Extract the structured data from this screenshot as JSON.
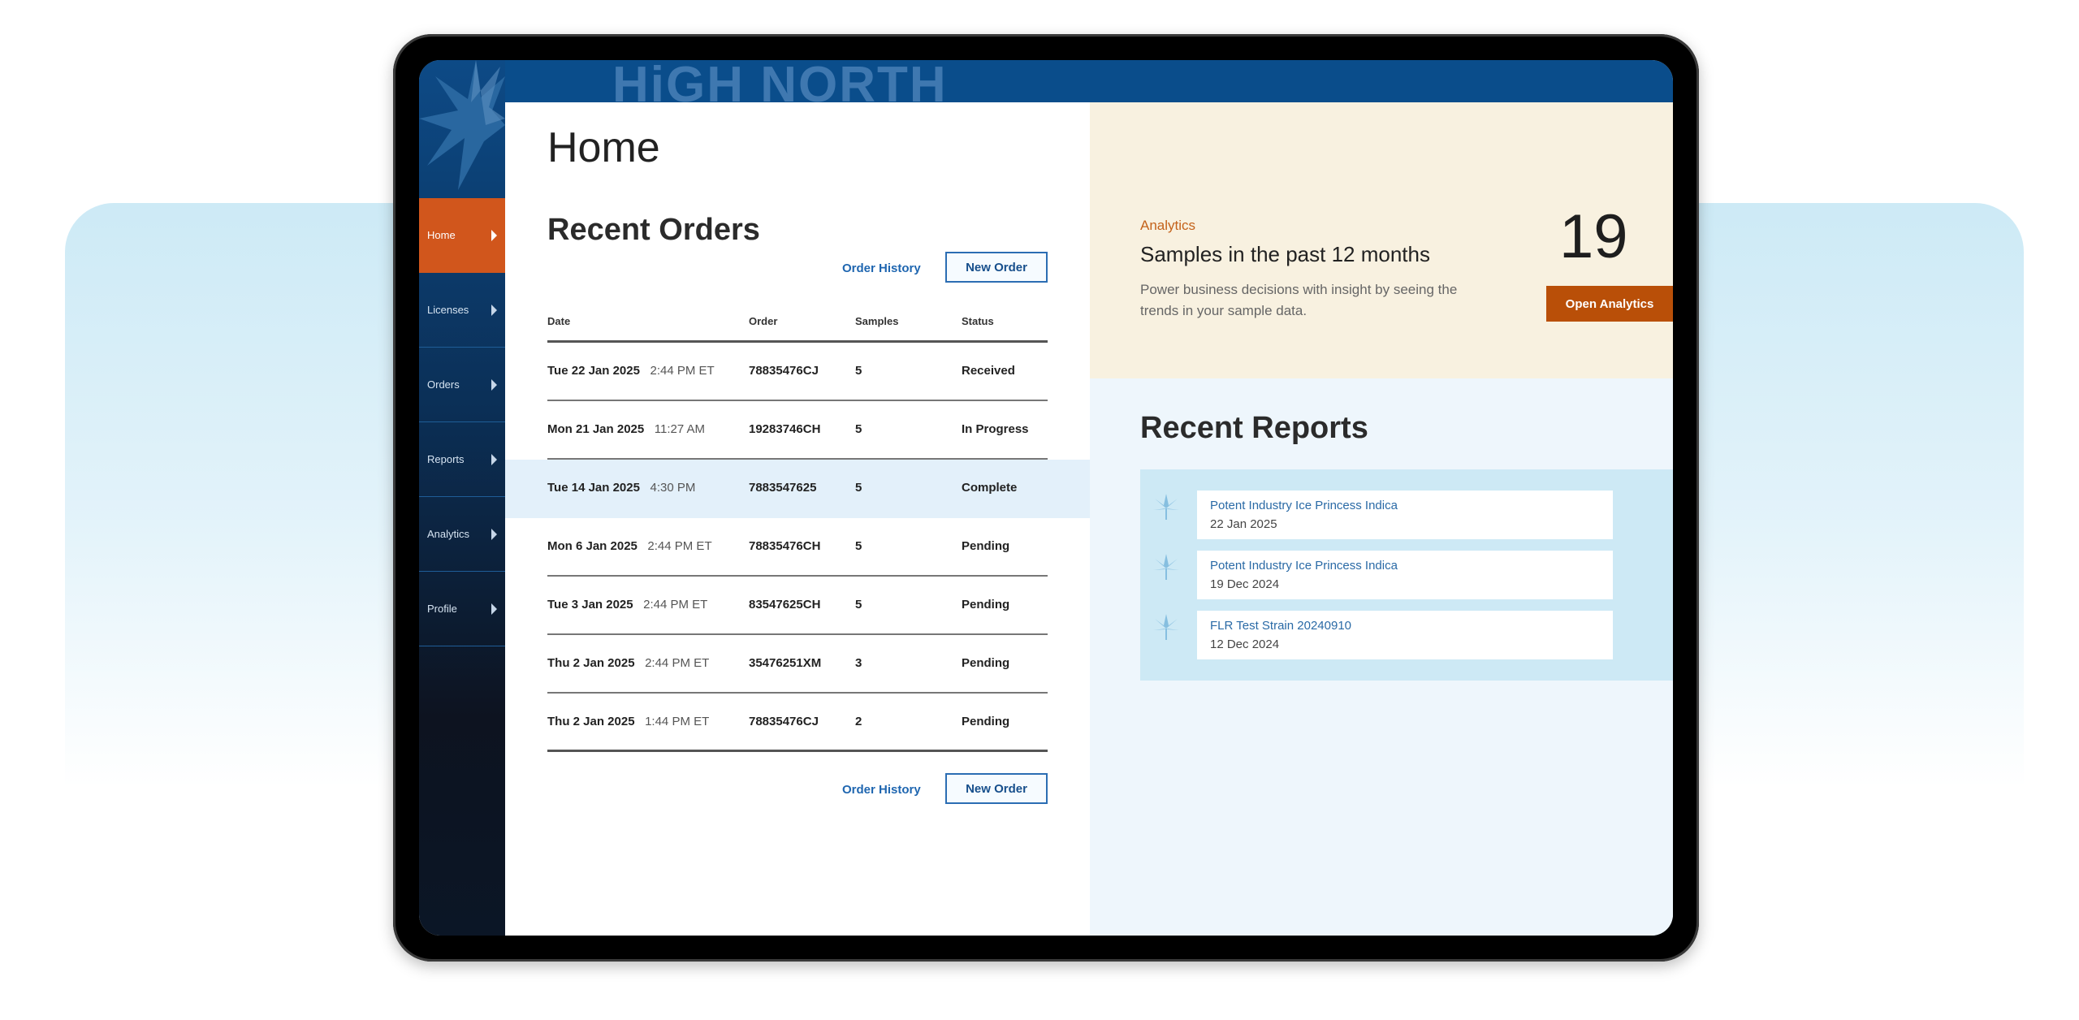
{
  "brand": {
    "banner_text": "HiGH NORTH"
  },
  "sidebar": {
    "items": [
      {
        "label": "Home",
        "active": true
      },
      {
        "label": "Licenses"
      },
      {
        "label": "Orders"
      },
      {
        "label": "Reports"
      },
      {
        "label": "Analytics"
      },
      {
        "label": "Profile"
      }
    ]
  },
  "home": {
    "title": "Home",
    "recent_orders": {
      "title": "Recent Orders",
      "order_history_label": "Order History",
      "new_order_label": "New Order",
      "columns": [
        "Date",
        "Order",
        "Samples",
        "Status"
      ],
      "rows": [
        {
          "date": "Tue 22 Jan 2025",
          "time": "2:44 PM ET",
          "order": "78835476CJ",
          "samples": "5",
          "status": "Received"
        },
        {
          "date": "Mon 21 Jan 2025",
          "time": "11:27 AM",
          "order": "19283746CH",
          "samples": "5",
          "status": "In Progress"
        },
        {
          "date": "Tue 14 Jan 2025",
          "time": "4:30 PM",
          "order": "7883547625",
          "samples": "5",
          "status": "Complete"
        },
        {
          "date": "Mon 6 Jan 2025",
          "time": "2:44 PM ET",
          "order": "78835476CH",
          "samples": "5",
          "status": "Pending"
        },
        {
          "date": "Tue 3 Jan 2025",
          "time": "2:44 PM ET",
          "order": "83547625CH",
          "samples": "5",
          "status": "Pending"
        },
        {
          "date": "Thu 2 Jan 2025",
          "time": "2:44 PM ET",
          "order": "35476251XM",
          "samples": "3",
          "status": "Pending"
        },
        {
          "date": "Thu 2 Jan 2025",
          "time": "1:44 PM ET",
          "order": "78835476CJ",
          "samples": "2",
          "status": "Pending"
        }
      ]
    }
  },
  "analytics": {
    "kicker": "Analytics",
    "title": "Samples in the past 12 months",
    "description": "Power business decisions with insight by seeing the trends in your sample data.",
    "count": "19",
    "button_label": "Open Analytics"
  },
  "reports": {
    "title": "Recent Reports",
    "items": [
      {
        "name": "Potent Industry Ice Princess Indica",
        "date": "22 Jan 2025"
      },
      {
        "name": "Potent Industry Ice Princess Indica",
        "date": "19 Dec 2024"
      },
      {
        "name": "FLR Test Strain 20240910",
        "date": "12 Dec 2024"
      }
    ]
  },
  "colors": {
    "accent_orange": "#d1561c",
    "brand_blue": "#0a4d8b",
    "link_blue": "#1f66b0",
    "analytics_bg": "#f8f1e0"
  }
}
